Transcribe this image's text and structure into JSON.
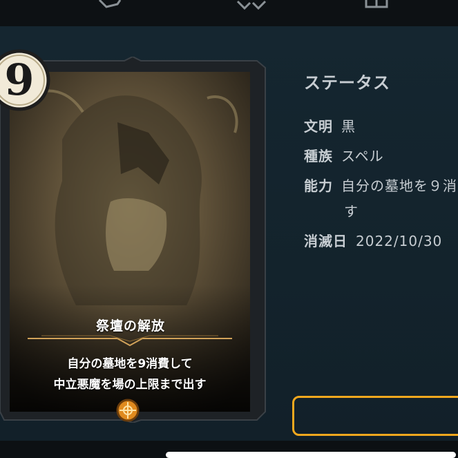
{
  "nav": {
    "icons": [
      "card-icon",
      "tools-icon",
      "grid-icon"
    ]
  },
  "card": {
    "cost": "9",
    "name": "祭壇の解放",
    "text_line1": "自分の墓地を9消費して",
    "text_line2": "中立悪魔を場の上限まで出す",
    "gem_icon": "civilization-gem-icon",
    "colors": {
      "frame": "#1e2226",
      "gold": "#d2a35a",
      "gem": "#e08a1e"
    }
  },
  "status": {
    "title": "ステータス",
    "civ_label": "文明",
    "civ_value": "黒",
    "type_label": "種族",
    "type_value": "スペル",
    "ability_label": "能力",
    "ability_value": "自分の墓地を９消",
    "ability_value_cont": "す",
    "expire_label": "消滅日",
    "expire_value": "2022/10/30"
  },
  "highlight_color": "#f2a81e"
}
